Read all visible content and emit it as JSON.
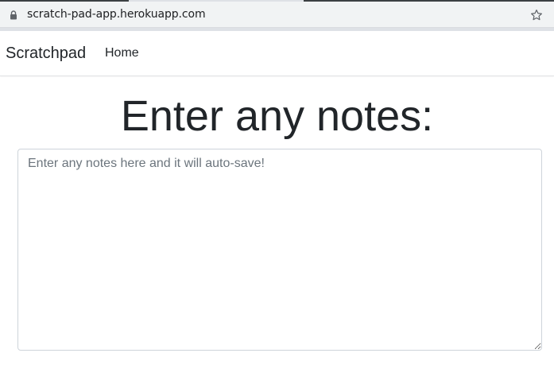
{
  "browser": {
    "url": "scratch-pad-app.herokuapp.com"
  },
  "navbar": {
    "brand": "Scratchpad",
    "links": [
      {
        "label": "Home"
      }
    ]
  },
  "main": {
    "title": "Enter any notes:",
    "notes_placeholder": "Enter any notes here and it will auto-save!",
    "notes_value": ""
  },
  "icons": {
    "lock": "lock-icon",
    "star": "bookmark-star-icon"
  }
}
